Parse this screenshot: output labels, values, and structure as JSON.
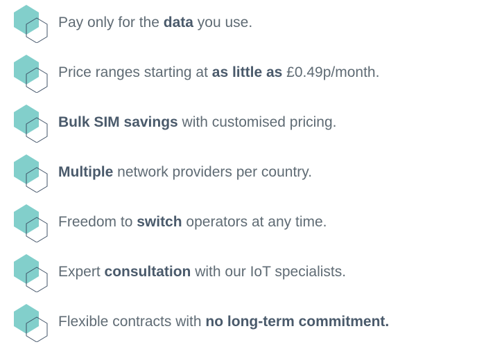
{
  "colors": {
    "hex_fill": "#82cfcb",
    "hex_outline": "#3f5166",
    "text": "#5f6b74",
    "bold_text": "#4a5a6b"
  },
  "icon": "hexagon-icon",
  "features": [
    {
      "parts": [
        {
          "text": "Pay only for the ",
          "bold": false
        },
        {
          "text": "data",
          "bold": true
        },
        {
          "text": " you use.",
          "bold": false
        }
      ]
    },
    {
      "parts": [
        {
          "text": "Price ranges starting at ",
          "bold": false
        },
        {
          "text": "as little as",
          "bold": true
        },
        {
          "text": " £0.49p/month.",
          "bold": false
        }
      ]
    },
    {
      "parts": [
        {
          "text": "Bulk SIM savings",
          "bold": true
        },
        {
          "text": " with customised pricing.",
          "bold": false
        }
      ]
    },
    {
      "parts": [
        {
          "text": "Multiple",
          "bold": true
        },
        {
          "text": " network providers per country.",
          "bold": false
        }
      ]
    },
    {
      "parts": [
        {
          "text": "Freedom to ",
          "bold": false
        },
        {
          "text": "switch",
          "bold": true
        },
        {
          "text": " operators at any time.",
          "bold": false
        }
      ]
    },
    {
      "parts": [
        {
          "text": "Expert ",
          "bold": false
        },
        {
          "text": "consultation",
          "bold": true
        },
        {
          "text": " with our IoT specialists.",
          "bold": false
        }
      ]
    },
    {
      "parts": [
        {
          "text": "Flexible contracts with ",
          "bold": false
        },
        {
          "text": "no long-term commitment.",
          "bold": true
        }
      ]
    }
  ]
}
